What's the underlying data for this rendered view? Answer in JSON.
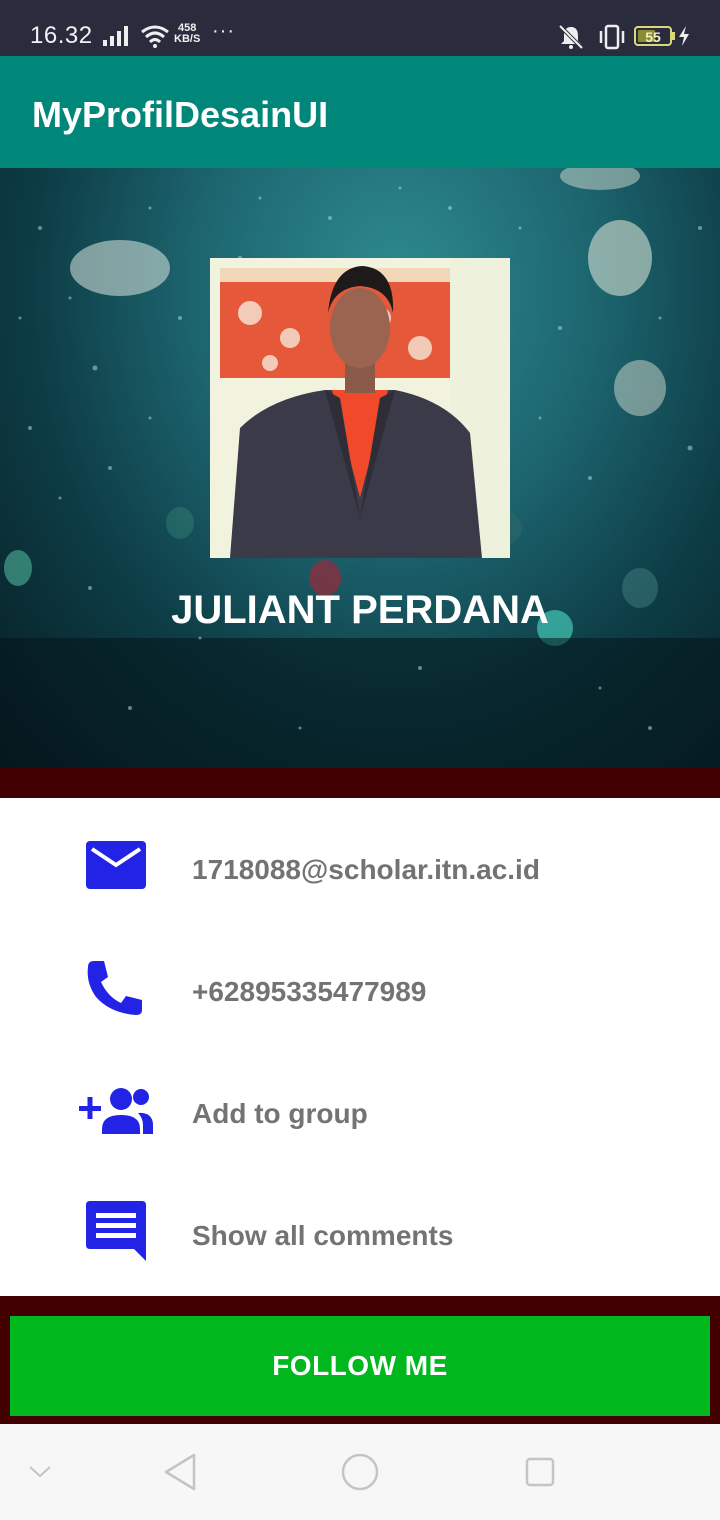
{
  "status_bar": {
    "time": "16.32",
    "speed_value": "458",
    "speed_unit": "KB/S",
    "more": "···",
    "battery": "55",
    "icons": [
      "signal-icon",
      "wifi-icon",
      "mute-vibrate-icon",
      "vibrate-icon",
      "battery-icon",
      "charging-icon"
    ]
  },
  "app_bar": {
    "title": "MyProfilDesainUI"
  },
  "profile": {
    "name": "JULIANT PERDANA"
  },
  "info": [
    {
      "icon": "email-icon",
      "text": "1718088@scholar.itn.ac.id"
    },
    {
      "icon": "phone-icon",
      "text": "+62895335477989"
    },
    {
      "icon": "add-group-icon",
      "text": "Add to group"
    },
    {
      "icon": "comment-icon",
      "text": "Show all comments"
    }
  ],
  "follow_button": {
    "label": "FOLLOW ME"
  },
  "nav_bar": {
    "icons": [
      "collapse-icon",
      "back-icon",
      "home-icon",
      "recents-icon"
    ]
  },
  "colors": {
    "status_bar": "#2a2b3d",
    "app_bar": "#00877a",
    "accent_icon": "#2323e6",
    "divider_strip": "#420000",
    "follow_button": "#00b81e",
    "info_text": "#737373"
  }
}
